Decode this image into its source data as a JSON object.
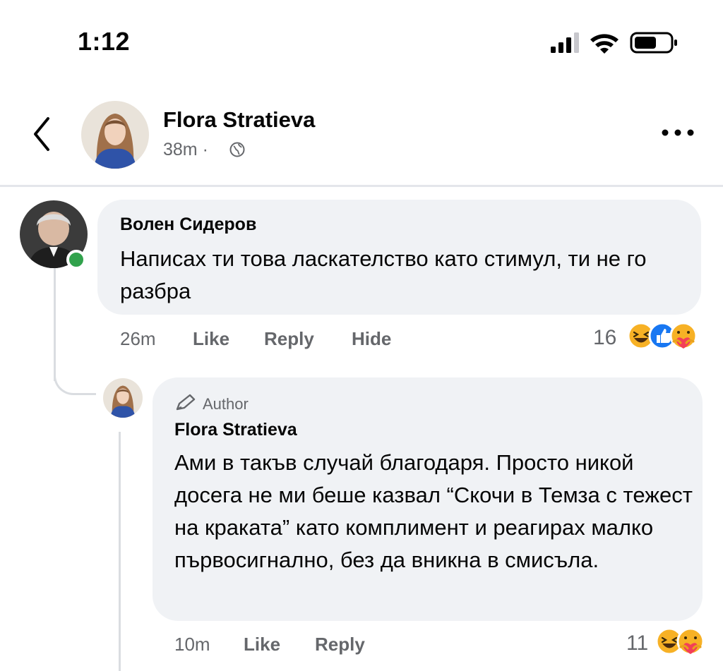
{
  "status_bar": {
    "time": "1:12"
  },
  "header": {
    "name": "Flora Stratieva",
    "time": "38m",
    "dot": "·"
  },
  "comments": [
    {
      "author": "Волен Сидеров",
      "text": "Написах ти това ласкателство като стимул, ти не го разбра",
      "time": "26m",
      "actions": {
        "like": "Like",
        "reply": "Reply",
        "hide": "Hide"
      },
      "reaction_count": "16",
      "reactions": [
        "haha-icon",
        "like-icon",
        "care-icon"
      ],
      "online": true
    },
    {
      "badge": "Author",
      "author": "Flora Stratieva",
      "text": "Ами в такъв случай благодаря. Просто никой досега не ми беше казвал “Скочи в Темза с тежест на краката” като комплимент и реагирах малко първосигнално, без да вникна в смисъла.",
      "time": "10m",
      "actions": {
        "like": "Like",
        "reply": "Reply"
      },
      "reaction_count": "11",
      "reactions": [
        "haha-icon",
        "care-icon"
      ]
    }
  ],
  "colors": {
    "bubble": "#f0f2f5",
    "muted": "#65676b",
    "online": "#31a24c",
    "like_blue": "#1877f2",
    "emoji_yellow": "#f7b125"
  }
}
